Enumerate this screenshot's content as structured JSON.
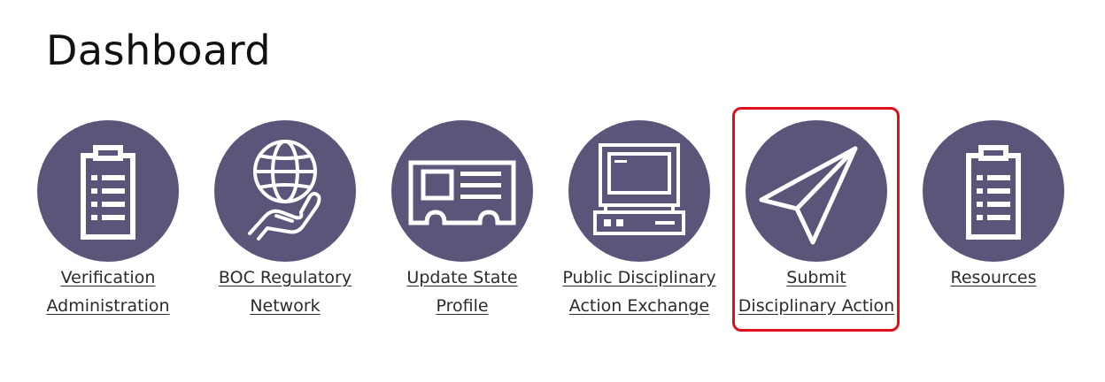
{
  "page": {
    "title": "Dashboard"
  },
  "colors": {
    "icon_circle": "#5c5479",
    "icon_stroke": "#ffffff",
    "selection_outline": "#e0101a"
  },
  "tiles": [
    {
      "icon": "clipboard-list-icon",
      "label_lines": [
        "Verification",
        "Administration"
      ]
    },
    {
      "icon": "globe-in-hand-icon",
      "label_lines": [
        "BOC Regulatory",
        "Network"
      ]
    },
    {
      "icon": "id-card-icon",
      "label_lines": [
        "Update State",
        "Profile"
      ]
    },
    {
      "icon": "computer-terminal-icon",
      "label_lines": [
        "Public Disciplinary",
        "Action Exchange"
      ]
    },
    {
      "icon": "paper-plane-icon",
      "label_lines": [
        "Submit",
        "Disciplinary Action"
      ],
      "selected": true
    },
    {
      "icon": "clipboard-list-icon",
      "label_lines": [
        "Resources"
      ]
    }
  ]
}
